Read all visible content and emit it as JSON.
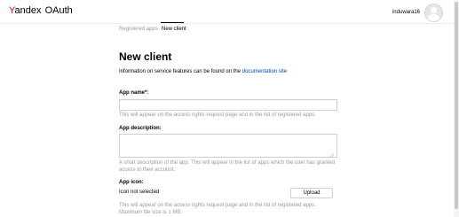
{
  "header": {
    "logo_ya_first": "Y",
    "logo_ya_rest": "andex",
    "logo_service": "OAuth",
    "username": "induwara16",
    "accent_color": "#ff0000"
  },
  "tabs": [
    {
      "label": "Registered apps",
      "active": false
    },
    {
      "label": "New client",
      "active": true
    }
  ],
  "page": {
    "title": "New client",
    "info_text": "Information on service features can be found on the",
    "info_link": "documentation site",
    "link_color": "#0044bb"
  },
  "form": {
    "app_name": {
      "label": "App name*:",
      "value": "",
      "hint": "This will appear on the access rights request page and in the list of registered apps."
    },
    "app_description": {
      "label": "App description:",
      "value": "",
      "hint": "A short description of the app. This will appear in the list of apps which the user has granted access to their account."
    },
    "app_icon": {
      "label": "App icon:",
      "status": "Icon not selected",
      "upload_label": "Upload",
      "hint": "This will appear on the access rights request page and in the list of registered apps. Maximum file size is 1 MB."
    }
  }
}
